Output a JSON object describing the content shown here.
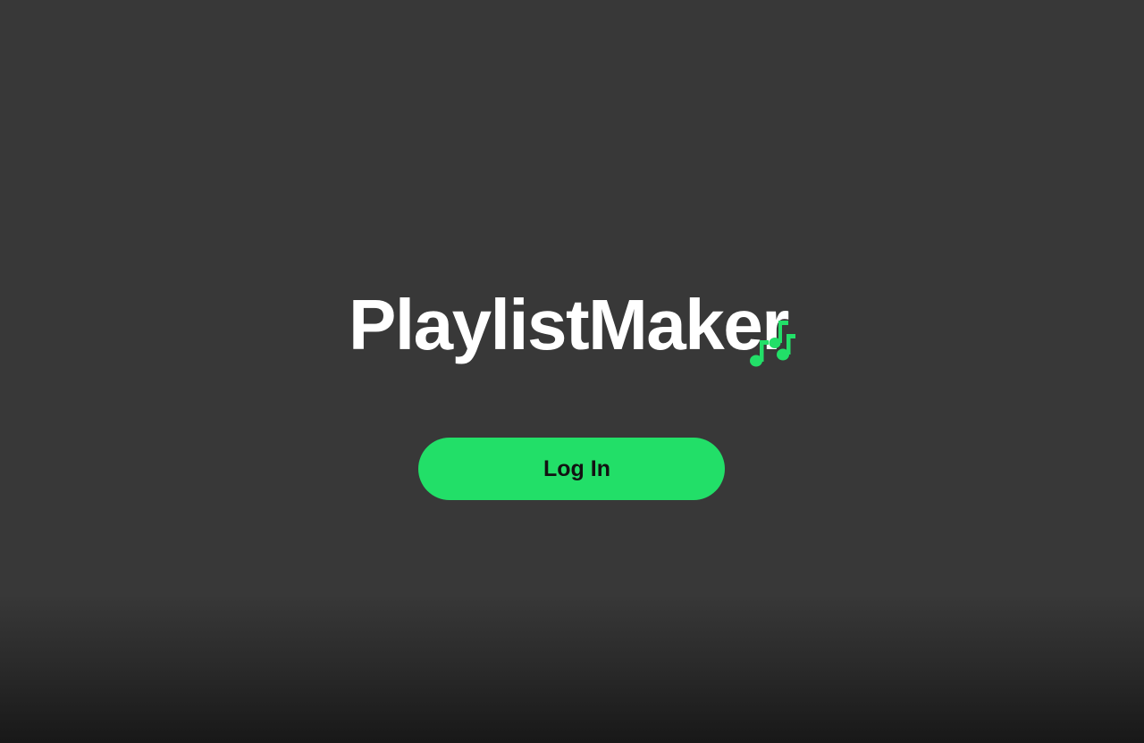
{
  "brand": {
    "title": "PlaylistMaker",
    "icon": "music-notes-icon"
  },
  "login": {
    "label": "Log In"
  },
  "colors": {
    "background": "#383838",
    "background_bottom": "#181818",
    "accent": "#22df68",
    "title_text": "#ffffff",
    "button_text": "#121212"
  }
}
